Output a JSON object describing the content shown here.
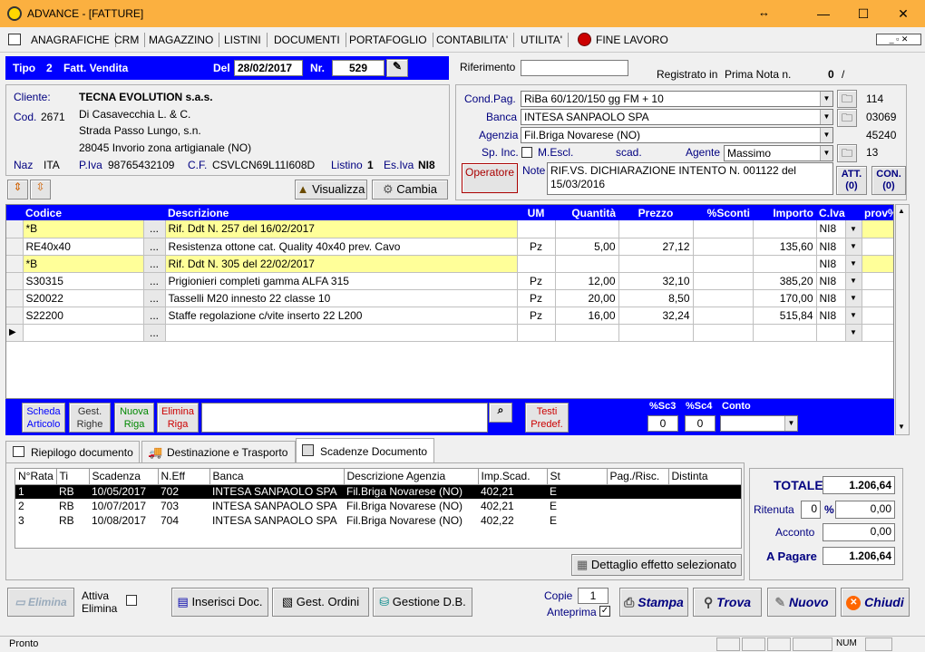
{
  "window": {
    "title": "ADVANCE - [FATTURE]",
    "resize_glyph": "↔",
    "min": "—",
    "max": "☐",
    "close": "✕"
  },
  "menu": [
    "ANAGRAFICHE",
    "CRM",
    "MAGAZZINO",
    "LISTINI",
    "DOCUMENTI",
    "PORTAFOGLIO",
    "CONTABILITA'",
    "UTILITA'",
    "FINE LAVORO"
  ],
  "header": {
    "tipo_label": "Tipo",
    "tipo_num": "2",
    "tipo_desc": "Fatt. Vendita",
    "del_label": "Del",
    "date": "28/02/2017",
    "nr_label": "Nr.",
    "nr": "529"
  },
  "rif": {
    "label": "Riferimento",
    "value": "",
    "registrato": "Registrato in",
    "prima_nota": "Prima Nota n.",
    "pn_num": "0",
    "pn_sep": "/"
  },
  "cliente": {
    "label": "Cliente:",
    "name": "TECNA EVOLUTION s.a.s.",
    "cod_label": "Cod.",
    "cod": "2671",
    "line2": "Di Casavecchia L. & C.",
    "line3": "Strada Passo Lungo, s.n.",
    "line4": "28045 Invorio  zona artigianale (NO)",
    "naz_label": "Naz",
    "naz": "ITA",
    "piva_label": "P.Iva",
    "piva": "98765432109",
    "cf_label": "C.F.",
    "cf": "CSVLCN69L11I608D",
    "listino_label": "Listino",
    "listino": "1",
    "esiva_label": "Es.Iva",
    "esiva": "NI8"
  },
  "cond": {
    "label": "Cond.Pag.",
    "value": "RiBa 60/120/150 gg FM + 10",
    "code": "114"
  },
  "banca": {
    "label": "Banca",
    "value": "INTESA SANPAOLO SPA",
    "code": "03069"
  },
  "agenzia": {
    "label": "Agenzia",
    "value": "Fil.Briga Novarese (NO)",
    "code": "45240"
  },
  "spinc": {
    "label": "Sp. Inc.",
    "mescl": "M.Escl.",
    "scad": "scad.",
    "agente_label": "Agente",
    "agente": "Massimo",
    "agente_code": "13"
  },
  "note": {
    "operatore": "Operatore",
    "label": "Note",
    "text": "RIF.VS. DICHIARAZIONE INTENTO N. 001122 del 15/03/2016",
    "att": "ATT.",
    "att_n": "(0)",
    "con": "CON.",
    "con_n": "(0)"
  },
  "toolbar": {
    "visualizza": "Visualizza",
    "cambia": "Cambia"
  },
  "grid": {
    "cols": [
      "Codice",
      "Descrizione",
      "UM",
      "Quantità",
      "Prezzo",
      "%Sconti",
      "Importo",
      "C.Iva",
      "prov%"
    ],
    "rows": [
      {
        "codice": "*B",
        "desc": "Rif. Ddt N. 257 del 16/02/2017",
        "um": "",
        "qta": "",
        "prezzo": "",
        "sconti": "",
        "importo": "",
        "iva": "NI8",
        "hl": true
      },
      {
        "codice": "RE40x40",
        "desc": "Resistenza ottone cat. Quality 40x40 prev. Cavo",
        "um": "Pz",
        "qta": "5,00",
        "prezzo": "27,12",
        "sconti": "",
        "importo": "135,60",
        "iva": "NI8",
        "hl": false
      },
      {
        "codice": "*B",
        "desc": "Rif. Ddt N. 305 del 22/02/2017",
        "um": "",
        "qta": "",
        "prezzo": "",
        "sconti": "",
        "importo": "",
        "iva": "NI8",
        "hl": true
      },
      {
        "codice": "S30315",
        "desc": "Prigionieri completi gamma ALFA 315",
        "um": "Pz",
        "qta": "12,00",
        "prezzo": "32,10",
        "sconti": "",
        "importo": "385,20",
        "iva": "NI8",
        "hl": false
      },
      {
        "codice": "S20022",
        "desc": "Tasselli M20 innesto 22 classe 10",
        "um": "Pz",
        "qta": "20,00",
        "prezzo": "8,50",
        "sconti": "",
        "importo": "170,00",
        "iva": "NI8",
        "hl": false
      },
      {
        "codice": "S22200",
        "desc": "Staffe regolazione c/vite inserto 22 L200",
        "um": "Pz",
        "qta": "16,00",
        "prezzo": "32,24",
        "sconti": "",
        "importo": "515,84",
        "iva": "NI8",
        "hl": false
      },
      {
        "codice": "",
        "desc": "",
        "um": "",
        "qta": "",
        "prezzo": "",
        "sconti": "",
        "importo": "",
        "iva": "",
        "hl": false
      }
    ]
  },
  "gridbar": {
    "scheda1": "Scheda",
    "scheda2": "Articolo",
    "gest1": "Gest.",
    "gest2": "Righe",
    "nuova1": "Nuova",
    "nuova2": "Riga",
    "elimina1": "Elimina",
    "elimina2": "Riga",
    "testi1": "Testi",
    "testi2": "Predef.",
    "sc3_label": "%Sc3",
    "sc3": "0",
    "sc4_label": "%Sc4",
    "sc4": "0",
    "conto_label": "Conto",
    "conto": ""
  },
  "tabs": [
    "Riepilogo documento",
    "Destinazione e Trasporto",
    "Scadenze Documento"
  ],
  "scad": {
    "cols": [
      "N°Rata",
      "Ti",
      "Scadenza",
      "N.Eff",
      "Banca",
      "Descrizione Agenzia",
      "Imp.Scad.",
      "St",
      "Pag./Risc.",
      "Distinta"
    ],
    "rows": [
      [
        "1",
        "RB",
        "10/05/2017",
        "702",
        "INTESA SANPAOLO SPA",
        "Fil.Briga Novarese (NO)",
        "402,21",
        "E",
        "",
        ""
      ],
      [
        "2",
        "RB",
        "10/07/2017",
        "703",
        "INTESA SANPAOLO SPA",
        "Fil.Briga Novarese (NO)",
        "402,21",
        "E",
        "",
        ""
      ],
      [
        "3",
        "RB",
        "10/08/2017",
        "704",
        "INTESA SANPAOLO SPA",
        "Fil.Briga Novarese (NO)",
        "402,22",
        "E",
        "",
        ""
      ]
    ],
    "dettaglio": "Dettaglio effetto selezionato"
  },
  "totals": {
    "totale_label": "TOTALE",
    "totale": "1.206,64",
    "ritenuta_label": "Ritenuta",
    "ritenuta_pct": "0",
    "pct": "%",
    "ritenuta": "0,00",
    "acconto_label": "Acconto",
    "acconto": "0,00",
    "apagare_label": "A Pagare",
    "apagare": "1.206,64"
  },
  "bottom": {
    "elimina": "Elimina",
    "attiva1": "Attiva",
    "attiva2": "Elimina",
    "inserisci": "Inserisci Doc.",
    "ordini": "Gest. Ordini",
    "gestione": "Gestione D.B.",
    "copie_label": "Copie",
    "copie": "1",
    "anteprima": "Anteprima",
    "stampa": "Stampa",
    "trova": "Trova",
    "nuovo": "Nuovo",
    "chiudi": "Chiudi"
  },
  "status": {
    "text": "Pronto",
    "num": "NUM"
  }
}
